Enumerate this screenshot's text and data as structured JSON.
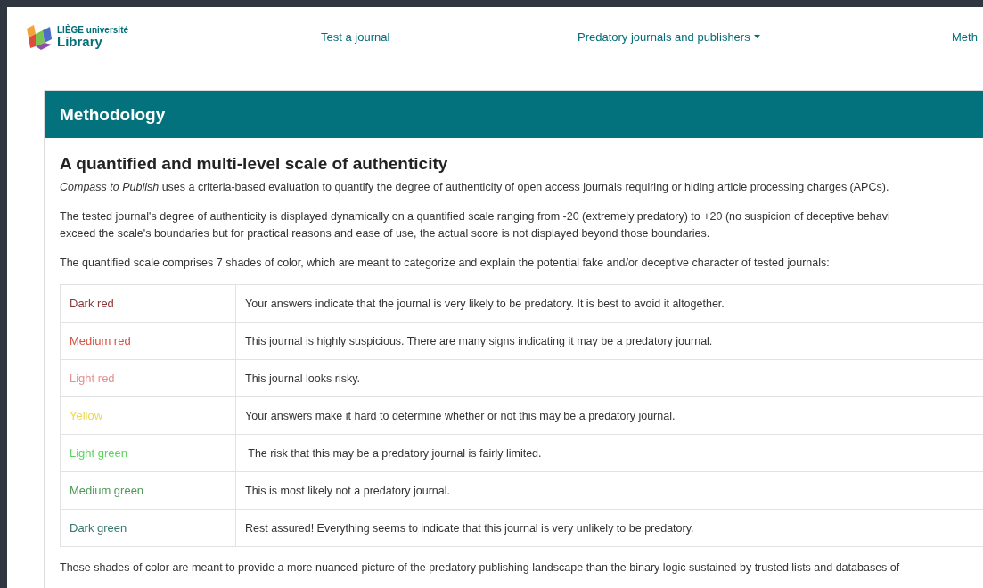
{
  "header": {
    "logo_top": "LIÈGE université",
    "logo_bottom": "Library",
    "nav": [
      {
        "label": "Test a journal",
        "dropdown": false
      },
      {
        "label": "Predatory journals and publishers",
        "dropdown": true
      },
      {
        "label": "Meth",
        "dropdown": false
      }
    ]
  },
  "card": {
    "title": "Methodology",
    "heading": "A quantified and multi-level scale of authenticity",
    "intro": "*Compass to Publish* uses a criteria-based evaluation to quantify the degree of authenticity of open access journals requiring or hiding article processing charges (APCs).",
    "paragraph_lines": [
      "The tested journal's degree of authenticity is displayed dynamically on a quantified scale ranging from -20 (extremely predatory) to +20 (no suspicion of deceptive behavi",
      "exceed the scale's boundaries but for practical reasons and ease of use, the actual score is not displayed beyond those boundaries."
    ],
    "scale_intro": "The quantified scale comprises 7 shades of color, which are meant to categorize and explain the potential fake and/or deceptive character of tested journals:",
    "table": [
      {
        "shade": "Dark red",
        "color": "#8b3a3a",
        "meaning": "Your answers indicate that the journal is very likely to be predatory. It is best to avoid it altogether."
      },
      {
        "shade": "Medium red",
        "color": "#d9503f",
        "meaning": "This journal is highly suspicious. There are many signs indicating it may be a predatory journal."
      },
      {
        "shade": "Light red",
        "color": "#e59090",
        "meaning": "This journal looks risky."
      },
      {
        "shade": "Yellow",
        "color": "#ecd84a",
        "meaning": "Your answers make it hard to determine whether or not this may be a predatory journal."
      },
      {
        "shade": "Light green",
        "color": "#5ed35e",
        "meaning": " The risk that this may be a predatory journal is fairly limited."
      },
      {
        "shade": "Medium green",
        "color": "#4e9a58",
        "meaning": "This is most likely not a predatory journal."
      },
      {
        "shade": "Dark green",
        "color": "#3b7570",
        "meaning": "Rest assured! Everything seems to indicate that this journal is very unlikely to be predatory."
      }
    ],
    "closing": "These shades of color are meant to provide a more nuanced picture of the predatory publishing landscape than the binary logic sustained by trusted lists and databases of"
  }
}
